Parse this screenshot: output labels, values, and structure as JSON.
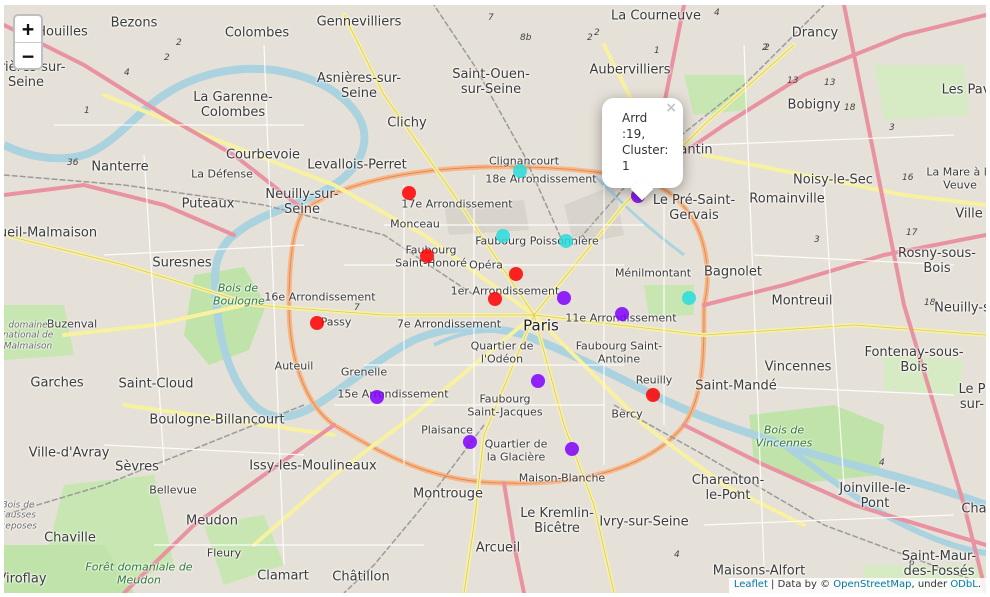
{
  "map": {
    "zoom": {
      "in_label": "+",
      "out_label": "−"
    },
    "places": {
      "bezons": "Bezons",
      "gennevilliers": "Gennevilliers",
      "la_courneuve": "La Courneuve",
      "drancy": "Drancy",
      "houilles": "Houilles",
      "colombes": "Colombes",
      "saint_ouen": "Saint-Ouen-sur-Seine",
      "aubervilliers": "Aubervilliers",
      "les_pav": "Les Pav",
      "arrieres": "arrières-sur-Seine",
      "asnieres": "Asnières-sur-Seine",
      "la_garenne": "La Garenne-Colombes",
      "bobigny": "Bobigny",
      "clichy": "Clichy",
      "courbevoie": "Courbevoie",
      "levallois": "Levallois-Perret",
      "nanterre": "Nanterre",
      "la_defense": "La Défense",
      "clignancourt": "Clignancourt",
      "arr18": "18e Arrondissement",
      "pantin": "antin",
      "noisy": "Noisy-le-Sec",
      "la_mare": "La Mare à la Veuve",
      "puteaux": "Puteaux",
      "neuilly": "Neuilly-sur-Seine",
      "arr17": "17e Arrondissement",
      "le_pre": "Le Pré-Saint-Gervais",
      "romainville": "Romainville",
      "ville": "Ville",
      "rueil": "ueil-Malmaison",
      "monceau": "Monceau",
      "fbg_poissonniere": "Faubourg Poissonnière",
      "suresnes": "Suresnes",
      "fbg_st_honore": "Faubourg Saint-Honoré",
      "bagnolet": "Bagnolet",
      "rosny": "Rosny-sous-Bois",
      "opera": "Opéra",
      "menilmontant": "Ménilmontant",
      "bois_boulogne": "Bois de Boulogne",
      "arr16": "16e Arrondissement",
      "arr1": "1er Arrondissement",
      "montreuil": "Montreuil",
      "neuilly_sur": "Neuilly-s",
      "buzenval": "Buzenval",
      "passy": "Passy",
      "arr7": "7e Arrondissement",
      "paris": "Paris",
      "arr11": "11e Arrondissement",
      "malmaison": "domaine national de Malmaison",
      "fbg_st_antoine": "Faubourg Saint-Antoine",
      "fontenay": "Fontenay-sous-Bois",
      "quartier_odeon": "Quartier de l'Odéon",
      "auteuil": "Auteuil",
      "grenelle": "Grenelle",
      "vincennes": "Vincennes",
      "garches": "Garches",
      "saint_cloud": "Saint-Cloud",
      "reuilly": "Reuilly",
      "saint_mande": "Saint-Mandé",
      "le_p": "Le P sur-",
      "arr15": "15e Arrondissement",
      "fbg_st_jacques": "Faubourg Saint-Jacques",
      "boulogne": "Boulogne-Billancourt",
      "bercy": "Bercy",
      "bois_vincennes": "Bois de Vincennes",
      "plaisance": "Plaisance",
      "quartier_glaciere": "Quartier de la Glacière",
      "ville_davray": "Ville-d'Avray",
      "sevres": "Sèvres",
      "issy": "Issy-les-Moulineaux",
      "maison_blanche": "Maison-Blanche",
      "charenton": "Charenton-le-Pont",
      "joinville": "Joinville-le-Pont",
      "cha": "Cha",
      "bellevue": "Bellevue",
      "montrouge": "Montrouge",
      "le_kremlin": "Le Kremlin-Bicêtre",
      "ivry": "Ivry-sur-Seine",
      "bois_fausses": "Bois de Fausses Reposes",
      "meudon": "Meudon",
      "chaville": "Chaville",
      "arcueil": "Arcueil",
      "fleury": "Fleury",
      "maisons_alfort": "Maisons-Alfort",
      "saint_maur": "Saint-Maur-des-Fossés",
      "foret_meudon": "Forêt domaniale de Meudon",
      "viroflay": "Viroflay",
      "clamart": "Clamart",
      "chatillon": "Châtillon"
    },
    "cluster_colors": {
      "red": "#ff0000",
      "purple": "#8000ff",
      "cyan": "#2adddd"
    },
    "markers": [
      {
        "name": "marker-17e",
        "cluster": "red"
      },
      {
        "name": "marker-18e",
        "cluster": "cyan"
      },
      {
        "name": "marker-19e",
        "cluster": "purple"
      },
      {
        "name": "marker-faubourg-poissonniere",
        "cluster": "cyan"
      },
      {
        "name": "marker-gare-du-nord",
        "cluster": "cyan"
      },
      {
        "name": "marker-8e",
        "cluster": "red"
      },
      {
        "name": "marker-9e",
        "cluster": "red"
      },
      {
        "name": "marker-2e",
        "cluster": "red"
      },
      {
        "name": "marker-3e",
        "cluster": "purple"
      },
      {
        "name": "marker-20e",
        "cluster": "cyan"
      },
      {
        "name": "marker-16e",
        "cluster": "red"
      },
      {
        "name": "marker-11e",
        "cluster": "purple"
      },
      {
        "name": "marker-5e",
        "cluster": "purple"
      },
      {
        "name": "marker-12e",
        "cluster": "red"
      },
      {
        "name": "marker-15e",
        "cluster": "purple"
      },
      {
        "name": "marker-14e",
        "cluster": "purple"
      },
      {
        "name": "marker-13e",
        "cluster": "purple"
      }
    ],
    "popup": {
      "line1": "Arrd",
      "line2": ":19,",
      "line3": "Cluster:",
      "line4": "1",
      "close": "×"
    },
    "attribution": {
      "leaflet": "Leaflet",
      "sep1": " | Data by © ",
      "osm": "OpenStreetMap",
      "sep2": ", under ",
      "odbl": "ODbL",
      "end": "."
    }
  }
}
